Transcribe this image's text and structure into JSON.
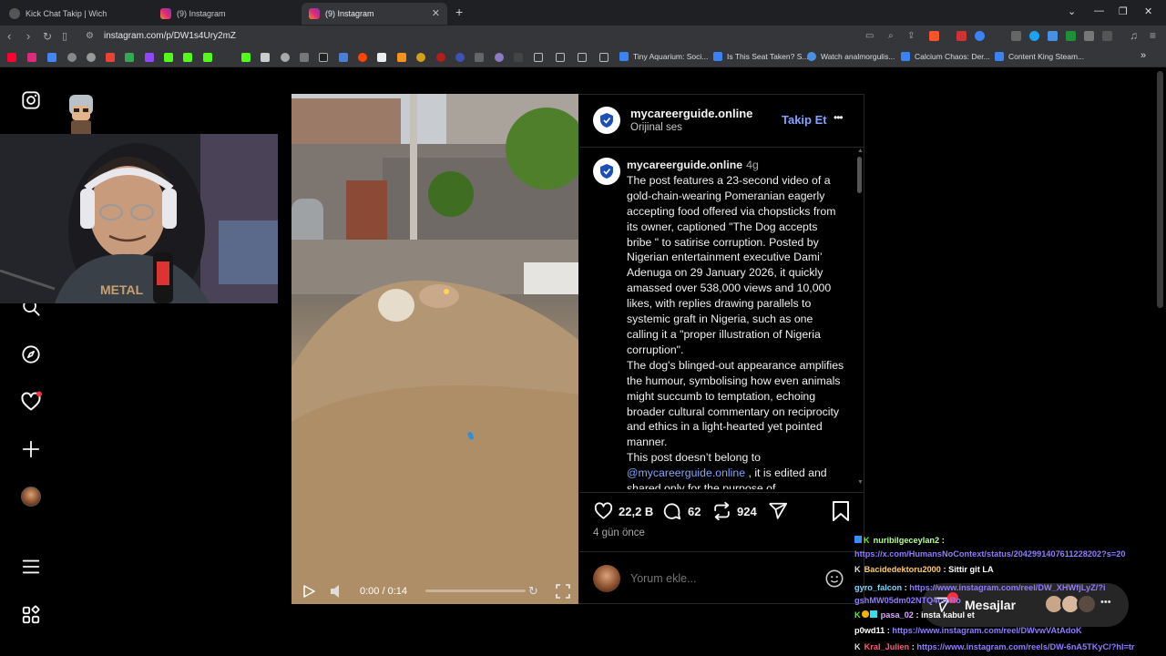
{
  "tabs": [
    {
      "title": "Kick Chat Takip | Wich",
      "active": false
    },
    {
      "title": "(9) Instagram",
      "active": false
    },
    {
      "title": "(9) Instagram",
      "active": true
    }
  ],
  "new_tab": "+",
  "address": {
    "url": "instagram.com/p/DW1s4Ury2mZ"
  },
  "bookmarks": [
    "Tiny Aquarium: Soci...",
    "Is This Seat Taken? S...",
    "Watch analmorgulis...",
    "Calcium Chaos: Der...",
    "Content King Steam..."
  ],
  "post": {
    "author": "mycareerguide.online",
    "audio": "Orijinal ses",
    "follow_label": "Takip Et",
    "more": "•••",
    "caption_user": "mycareerguide.online",
    "caption_time": "4g",
    "caption_p1": "The post features a 23-second video of a gold-chain-wearing Pomeranian eagerly accepting food offered via chopsticks from its owner, captioned \"The Dog accepts bribe \" to satirise corruption. Posted by Nigerian entertainment executive Dami’ Adenuga on 29 January 2026, it quickly amassed over 538,000 views and 10,000 likes, with replies drawing parallels to systemic graft in Nigeria, such as one calling it a \"proper illustration of Nigeria corruption\".",
    "caption_p2": "The dog's blinged-out appearance amplifies the humour, symbolising how even animals might succumb to temptation, echoing broader cultural commentary on reciprocity and ethics in a light-hearted yet pointed manner.",
    "caption_p3_pre": "This post doesn’t belong to",
    "caption_mention": "@mycareerguide.online",
    "caption_p3_post": ", it is edited and shared only for the purpose of",
    "likes": "22,2 B",
    "comments": "62",
    "reposts": "924",
    "posted": "4 gün önce",
    "comment_placeholder": "Yorum ekle..."
  },
  "video": {
    "time": "0:00 / 0:14",
    "progress": 0.0
  },
  "messages_label": "Mesajlar",
  "chat": [
    {
      "user": "nuribilgeceylan2",
      "user_color": "#b6ff8f",
      "text": "https://x.com/HumansNoContext/status/2042991407611228202?s=20",
      "is_link": true
    },
    {
      "user": "Bacidedektoru2000",
      "user_color": "#ffcc66",
      "text": "Sittir git LA",
      "is_link": false
    },
    {
      "user": "gyro_falcon",
      "user_color": "#7ad7ff",
      "text": "https://www.instagram.com/reel/DW_XHWfjLyZ/?igshMW05dm02NTQ4cmRo",
      "is_link": true
    },
    {
      "user": "pasa_02",
      "user_color": "#d9a6ff",
      "text": "insta kabul et",
      "is_link": false
    },
    {
      "user": "p0wd11",
      "user_color": "#ffffff",
      "text": "https://www.instagram.com/reel/DWvwVAtAdoK",
      "is_link": true
    },
    {
      "user": "Kral_Julien",
      "user_color": "#ff5a7a",
      "text": "https://www.instagram.com/reels/DW-6nA5TKyC/?hl=tr",
      "is_link": true
    }
  ],
  "colors": {
    "accent_link": "#8f7bff",
    "follow_blue": "#85a1ff",
    "notification_red": "#ff3040",
    "brave_orange": "#fb542b"
  }
}
